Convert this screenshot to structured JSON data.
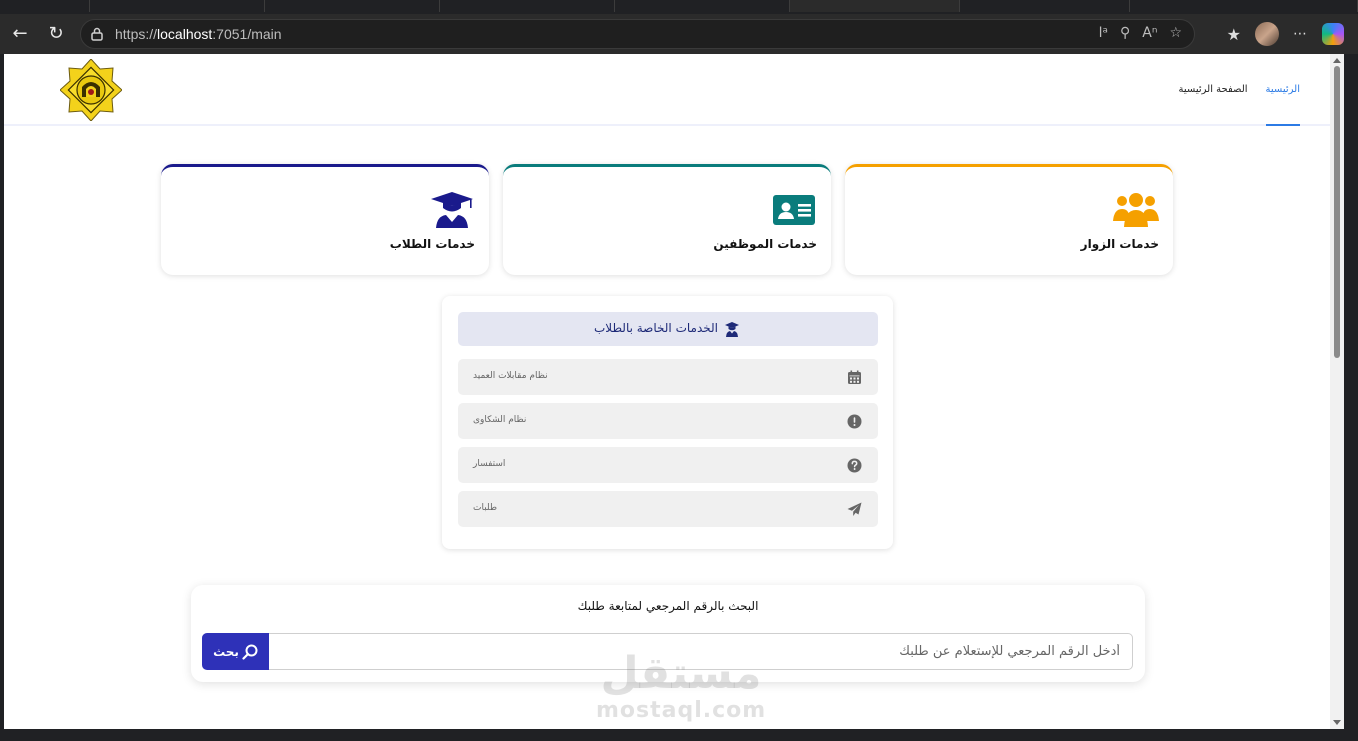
{
  "browser": {
    "url_prefix": "https://",
    "url_host": "localhost",
    "url_rest": ":7051/main"
  },
  "header": {
    "nav": [
      {
        "label": "الرئيسية",
        "active": true
      },
      {
        "label": "الصفحة الرئيسية",
        "active": false
      }
    ]
  },
  "cards": [
    {
      "title": "خدمات الزوار",
      "color": "#f5a000",
      "icon": "users-icon"
    },
    {
      "title": "خدمات الموظفين",
      "color": "#0a7c7c",
      "icon": "id-card-icon"
    },
    {
      "title": "خدمات الطلاب",
      "color": "#1a1a8c",
      "icon": "graduate-icon"
    }
  ],
  "student_panel": {
    "heading": "الخدمات الخاصة بالطلاب",
    "items": [
      {
        "label": "نظام مقابلات العميد",
        "icon": "calendar-icon"
      },
      {
        "label": "نظام الشكاوى",
        "icon": "alert-circle-icon"
      },
      {
        "label": "استفسار",
        "icon": "question-circle-icon"
      },
      {
        "label": "طلبات",
        "icon": "send-icon"
      }
    ]
  },
  "search": {
    "title": "البحث بالرقم المرجعي لمتابعة طلبك",
    "placeholder": "أدخل الرقم المرجعي للإستعلام عن طلبك",
    "button_label": "بحث"
  },
  "watermark": {
    "arabic": "مستقل",
    "latin": "mostaql.com"
  }
}
